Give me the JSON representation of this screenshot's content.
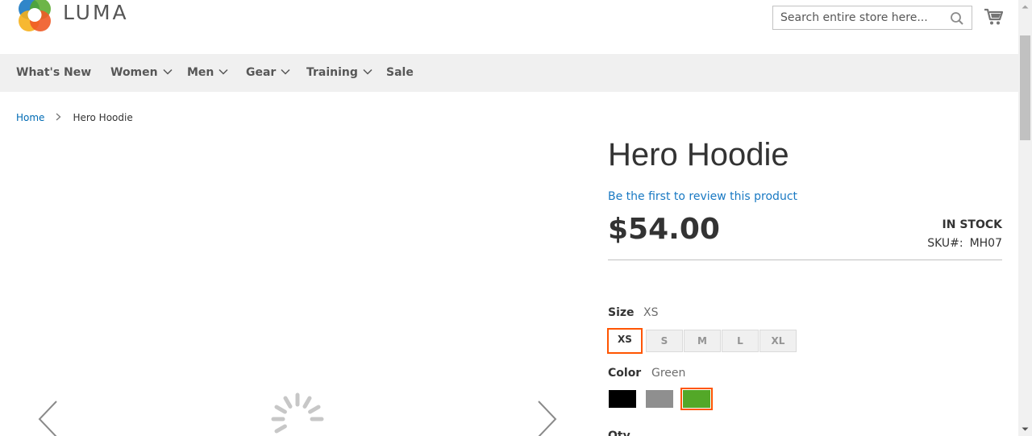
{
  "header": {
    "logo_text": "LUMA",
    "search_placeholder": "Search entire store here...",
    "cart_icon": "cart-icon",
    "search_icon": "search-icon"
  },
  "nav": {
    "items": [
      {
        "label": "What's New",
        "has_dropdown": false
      },
      {
        "label": "Women",
        "has_dropdown": true
      },
      {
        "label": "Men",
        "has_dropdown": true
      },
      {
        "label": "Gear",
        "has_dropdown": true
      },
      {
        "label": "Training",
        "has_dropdown": true
      },
      {
        "label": "Sale",
        "has_dropdown": false
      }
    ]
  },
  "breadcrumb": {
    "home": "Home",
    "current": "Hero Hoodie"
  },
  "product": {
    "title": "Hero Hoodie",
    "review_link": "Be the first to review this product",
    "price": "$54.00",
    "stock": "IN STOCK",
    "sku_label": "SKU#:",
    "sku": "MH07"
  },
  "options": {
    "size_label": "Size",
    "size_selected": "XS",
    "sizes": [
      "XS",
      "S",
      "M",
      "L",
      "XL"
    ],
    "color_label": "Color",
    "color_selected": "Green",
    "colors": [
      {
        "name": "Black",
        "hex": "#000000"
      },
      {
        "name": "Gray",
        "hex": "#8f8f8f"
      },
      {
        "name": "Green",
        "hex": "#53a828"
      }
    ],
    "qty_label": "Qty"
  },
  "colors": {
    "accent": "#ff5501",
    "link": "#1979c3",
    "nav_bg": "#f0f0f0"
  }
}
